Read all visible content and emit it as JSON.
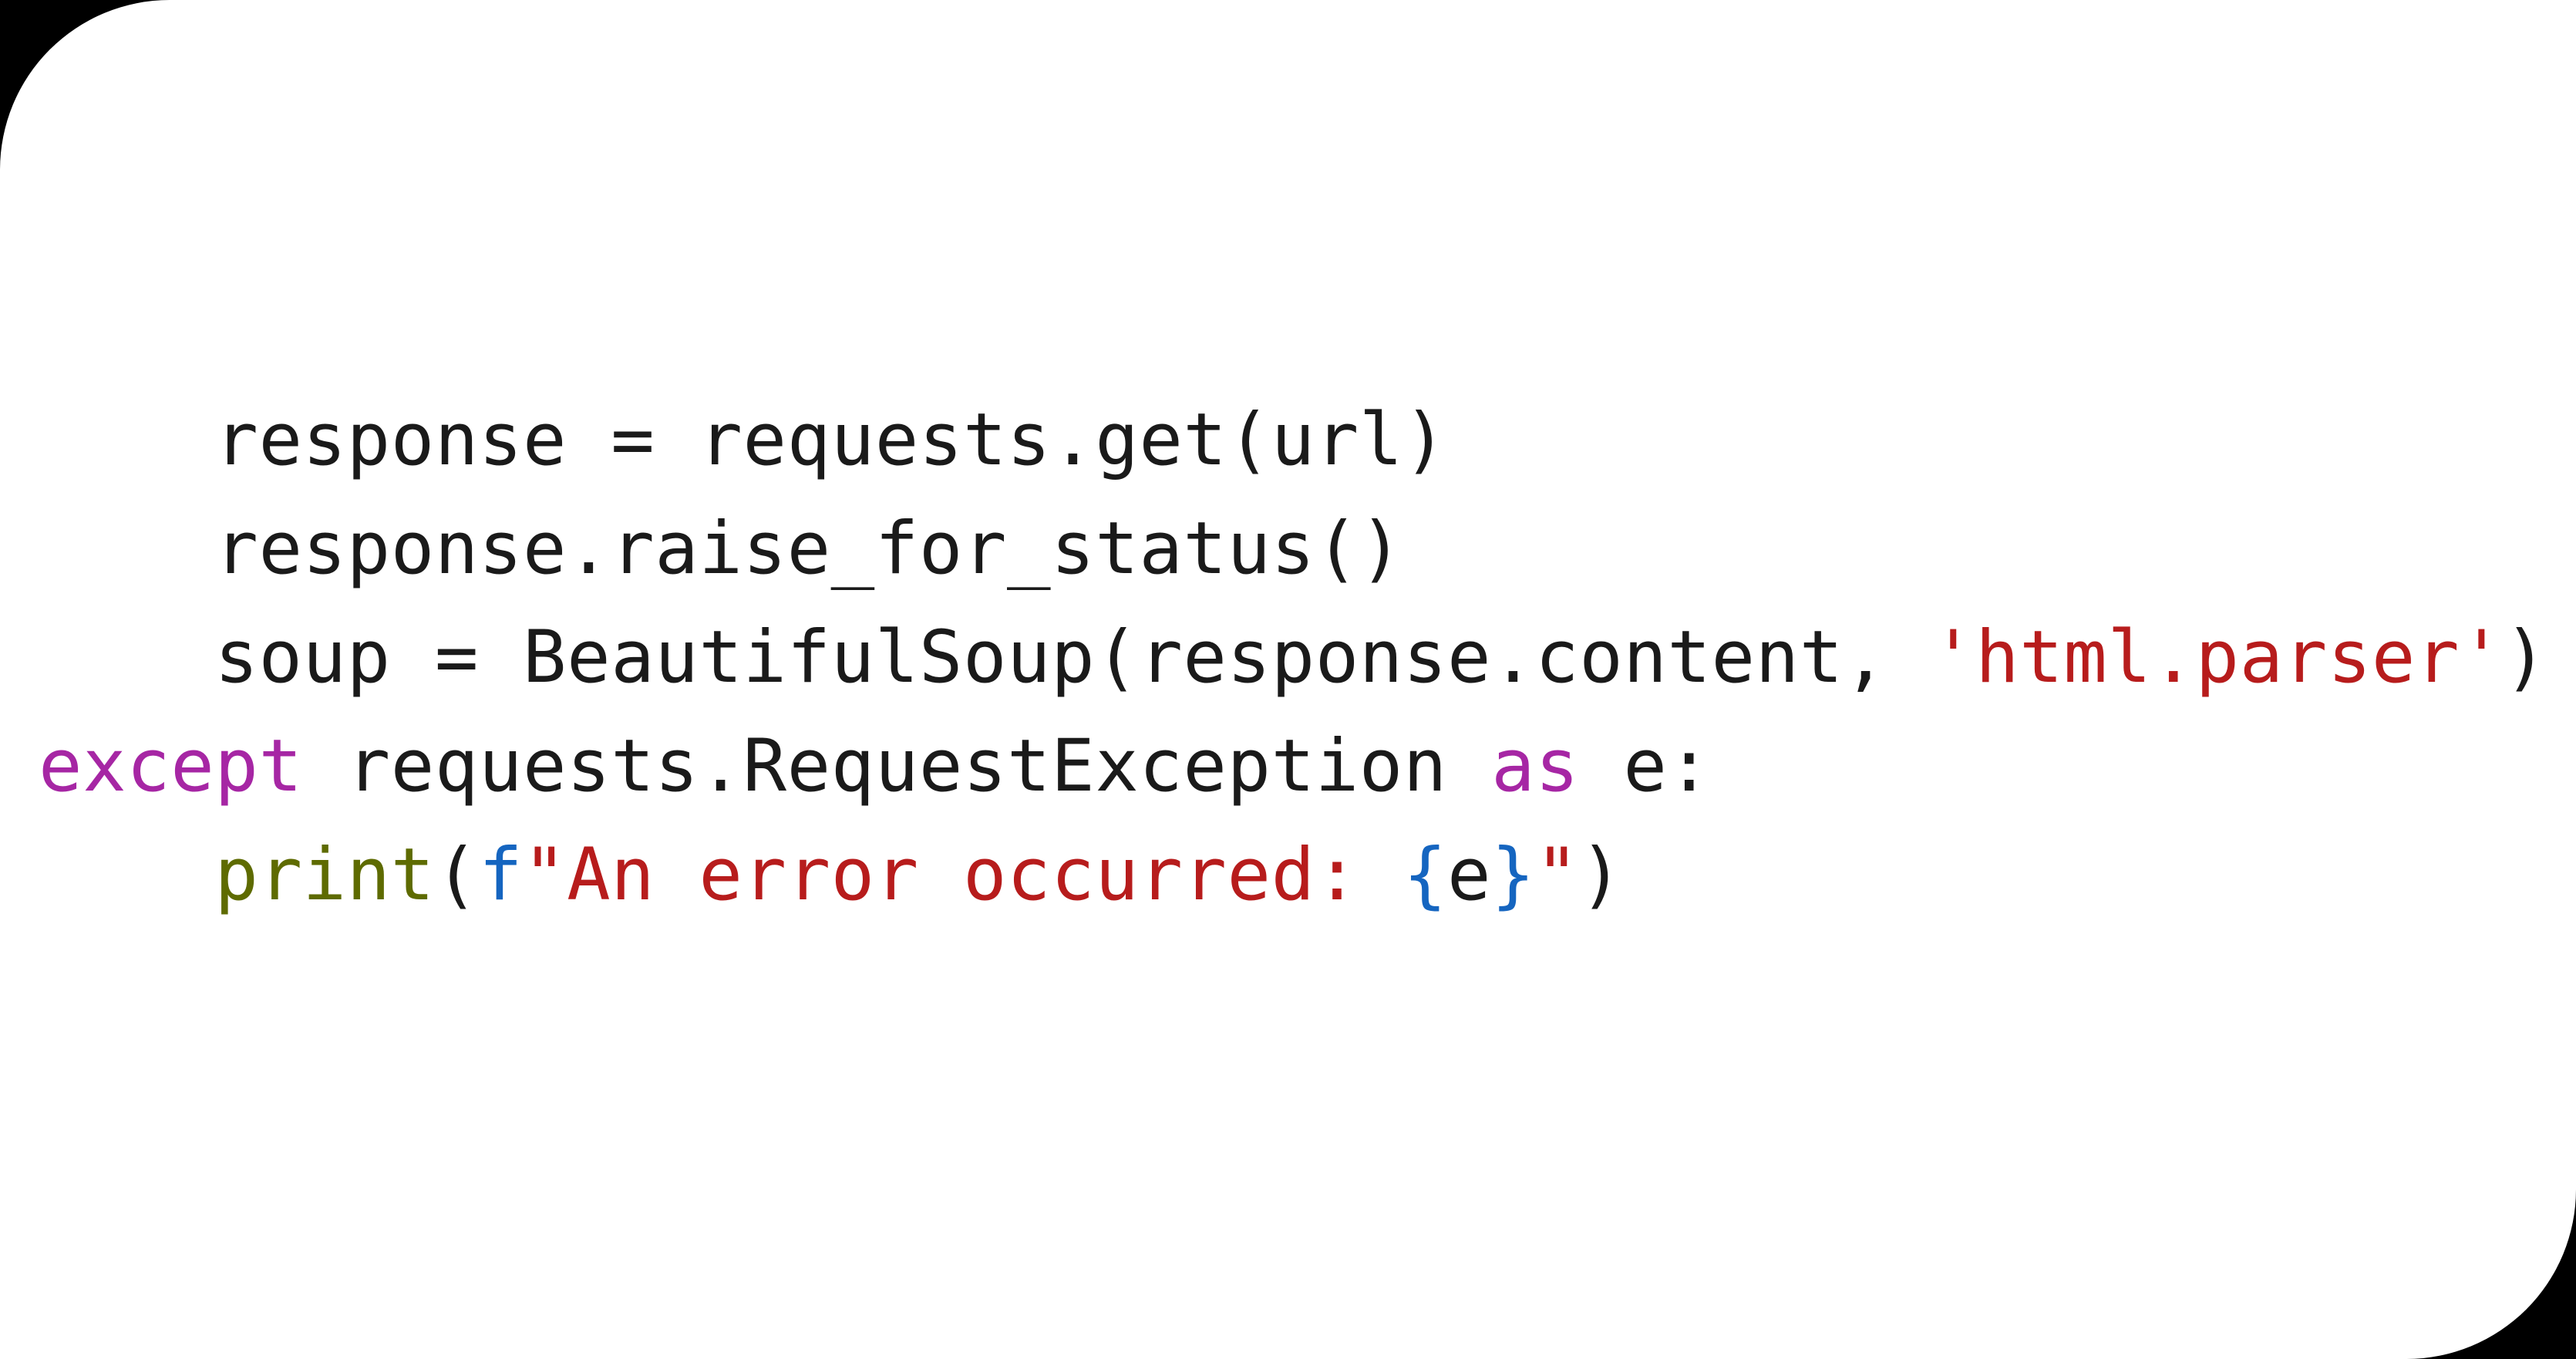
{
  "code": {
    "lines": [
      {
        "indent": "    ",
        "tokens": [
          {
            "text": "response = requests.get(url)",
            "class": ""
          }
        ]
      },
      {
        "indent": "    ",
        "tokens": [
          {
            "text": "response.raise_for_status()",
            "class": ""
          }
        ]
      },
      {
        "indent": "    ",
        "tokens": [
          {
            "text": "soup = BeautifulSoup(response.content, ",
            "class": ""
          },
          {
            "text": "'html.parser'",
            "class": "str"
          },
          {
            "text": ")",
            "class": ""
          }
        ]
      },
      {
        "indent": "",
        "tokens": [
          {
            "text": "except",
            "class": "kw"
          },
          {
            "text": " requests.RequestException ",
            "class": ""
          },
          {
            "text": "as",
            "class": "kw"
          },
          {
            "text": " e:",
            "class": ""
          }
        ]
      },
      {
        "indent": "    ",
        "tokens": [
          {
            "text": "print",
            "class": "builtin"
          },
          {
            "text": "(",
            "class": ""
          },
          {
            "text": "f",
            "class": "fstr-prefix"
          },
          {
            "text": "\"An error occurred: ",
            "class": "str"
          },
          {
            "text": "{",
            "class": "fstr-brace"
          },
          {
            "text": "e",
            "class": ""
          },
          {
            "text": "}",
            "class": "fstr-brace"
          },
          {
            "text": "\"",
            "class": "str"
          },
          {
            "text": ")",
            "class": ""
          }
        ]
      }
    ]
  }
}
